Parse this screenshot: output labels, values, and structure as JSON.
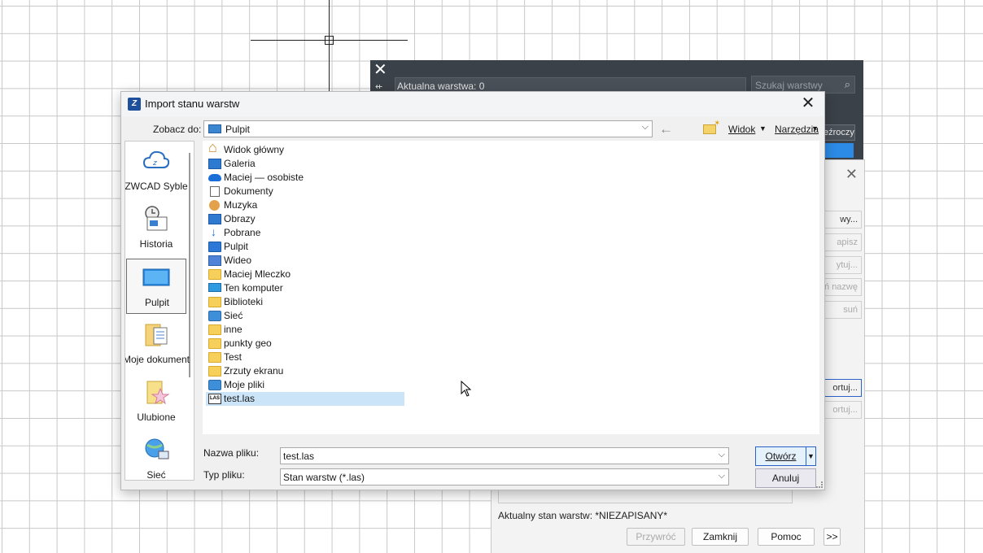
{
  "layer_panel": {
    "current_layer": "Aktualna warstwa: 0",
    "search_placeholder": "Szukaj warstwy",
    "tag_partial": "eźroczy"
  },
  "states_dialog": {
    "buttons": [
      "wy...",
      "apisz",
      "ytuj...",
      "ń nazwę",
      "suń",
      "ortuj...",
      "ortuj..."
    ],
    "current_state": "Aktualny stan warstw: *NIEZAPISANY*",
    "footer": {
      "restore": "Przywróć",
      "close": "Zamknij",
      "help": "Pomoc",
      "more": ">>"
    }
  },
  "dialog": {
    "title": "Import stanu warstw",
    "look_in_label": "Zobacz do:",
    "look_in_value": "Pulpit",
    "view_menu": "Widok",
    "tools_menu": "Narzędzia",
    "places": [
      "ZWCAD Syble",
      "Historia",
      "Pulpit",
      "Moje dokument",
      "Ulubione",
      "Sieć"
    ],
    "files": [
      {
        "name": "Widok główny",
        "icon": "home-icon"
      },
      {
        "name": "Galeria",
        "icon": "gallery-icon"
      },
      {
        "name": "Maciej — osobiste",
        "icon": "cloud-icon"
      },
      {
        "name": "Dokumenty",
        "icon": "document-icon"
      },
      {
        "name": "Muzyka",
        "icon": "music-icon"
      },
      {
        "name": "Obrazy",
        "icon": "pictures-icon"
      },
      {
        "name": "Pobrane",
        "icon": "download-icon"
      },
      {
        "name": "Pulpit",
        "icon": "desktop-icon"
      },
      {
        "name": "Wideo",
        "icon": "video-icon"
      },
      {
        "name": "Maciej Mleczko",
        "icon": "folder-icon"
      },
      {
        "name": "Ten komputer",
        "icon": "computer-icon"
      },
      {
        "name": "Biblioteki",
        "icon": "folder-icon"
      },
      {
        "name": "Sieć",
        "icon": "network-icon"
      },
      {
        "name": "inne",
        "icon": "folder-icon"
      },
      {
        "name": "punkty geo",
        "icon": "folder-icon"
      },
      {
        "name": "Test",
        "icon": "folder-icon"
      },
      {
        "name": "Zrzuty ekranu",
        "icon": "folder-icon"
      },
      {
        "name": "Moje pliki",
        "icon": "network-folder-icon"
      },
      {
        "name": "test.las",
        "icon": "las-file-icon"
      }
    ],
    "file_name_label": "Nazwa pliku:",
    "file_name_value": "test.las",
    "file_type_label": "Typ pliku:",
    "file_type_value": "Stan warstw (*.las)",
    "open_button": "Otwórz",
    "cancel_button": "Anuluj"
  }
}
